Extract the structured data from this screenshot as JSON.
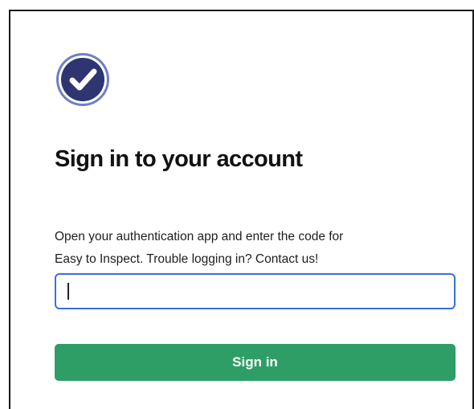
{
  "logo": {
    "icon": "check-circle-icon",
    "colors": {
      "outer_ring": "#6f7fc2",
      "inner_disk": "#2e3570",
      "check": "#ffffff"
    }
  },
  "page_title": "Sign in to your account",
  "instructions": {
    "line1": "Open your authentication app and enter the code for",
    "line2": "Easy to Inspect. Trouble logging in? Contact us!"
  },
  "code_input": {
    "value": "",
    "placeholder": "",
    "focused": true,
    "border_color": "#3a6fd8"
  },
  "signin_button": {
    "label": "Sign in",
    "color": "#2e9e66"
  }
}
